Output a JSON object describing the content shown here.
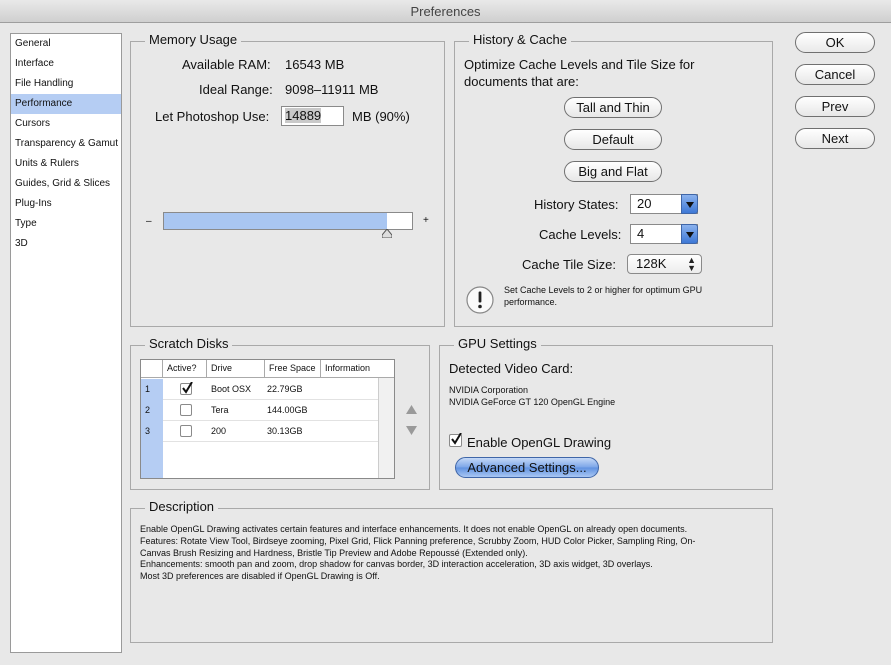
{
  "window": {
    "title": "Preferences"
  },
  "sidebar": {
    "items": [
      {
        "label": "General"
      },
      {
        "label": "Interface"
      },
      {
        "label": "File Handling"
      },
      {
        "label": "Performance",
        "selected": true
      },
      {
        "label": "Cursors"
      },
      {
        "label": "Transparency & Gamut"
      },
      {
        "label": "Units & Rulers"
      },
      {
        "label": "Guides, Grid & Slices"
      },
      {
        "label": "Plug-Ins"
      },
      {
        "label": "Type"
      },
      {
        "label": "3D"
      }
    ]
  },
  "memory": {
    "title": "Memory Usage",
    "available_label": "Available RAM:",
    "available_value": "16543 MB",
    "ideal_label": "Ideal Range:",
    "ideal_value": "9098–11911 MB",
    "let_label": "Let Photoshop Use:",
    "let_value": "14889",
    "let_suffix": "MB (90%)",
    "slider_minus": "–",
    "slider_plus": "+",
    "slider_level": 0.9
  },
  "history": {
    "title": "History & Cache",
    "optimize_line1": "Optimize Cache Levels and Tile Size for",
    "optimize_line2": "documents that are:",
    "btn_tall": "Tall and Thin",
    "btn_default": "Default",
    "btn_big": "Big and Flat",
    "history_states_label": "History States:",
    "history_states_value": "20",
    "cache_levels_label": "Cache Levels:",
    "cache_levels_value": "4",
    "tile_size_label": "Cache Tile Size:",
    "tile_size_value": "128K",
    "warning_line1": "Set Cache Levels to 2 or higher for optimum GPU",
    "warning_line2": "performance."
  },
  "scratch": {
    "title": "Scratch Disks",
    "headers": [
      "Active?",
      "Drive",
      "Free Space",
      "Information"
    ],
    "rows": [
      {
        "num": "1",
        "active": true,
        "drive": "Boot OSX",
        "free": "22.79GB",
        "info": ""
      },
      {
        "num": "2",
        "active": false,
        "drive": "Tera",
        "free": "144.00GB",
        "info": ""
      },
      {
        "num": "3",
        "active": false,
        "drive": "200",
        "free": "30.13GB",
        "info": ""
      }
    ]
  },
  "gpu": {
    "title": "GPU Settings",
    "detected_label": "Detected Video Card:",
    "vendor": "NVIDIA Corporation",
    "card": "NVIDIA GeForce GT 120 OpenGL Engine",
    "enable_label": "Enable OpenGL Drawing",
    "enable_checked": true,
    "advanced_label": "Advanced Settings..."
  },
  "description": {
    "title": "Description",
    "lines": [
      "Enable OpenGL Drawing activates certain features and interface enhancements. It does not enable OpenGL on already open documents.",
      "Features: Rotate View Tool, Birdseye zooming, Pixel Grid, Flick Panning preference, Scrubby Zoom, HUD Color Picker, Sampling Ring, On-",
      "Canvas Brush Resizing and Hardness, Bristle Tip Preview and Adobe Repoussé (Extended only).",
      "Enhancements: smooth pan and zoom, drop shadow for canvas border, 3D interaction acceleration, 3D axis widget, 3D overlays.",
      "Most 3D preferences are disabled if OpenGL Drawing is Off."
    ]
  },
  "buttons": {
    "ok": "OK",
    "cancel": "Cancel",
    "prev": "Prev",
    "next": "Next"
  },
  "colors": {
    "selection": "#b5cdf3",
    "slider_fill": "#a9c6f1",
    "accent_blue": "#5f91e0"
  }
}
